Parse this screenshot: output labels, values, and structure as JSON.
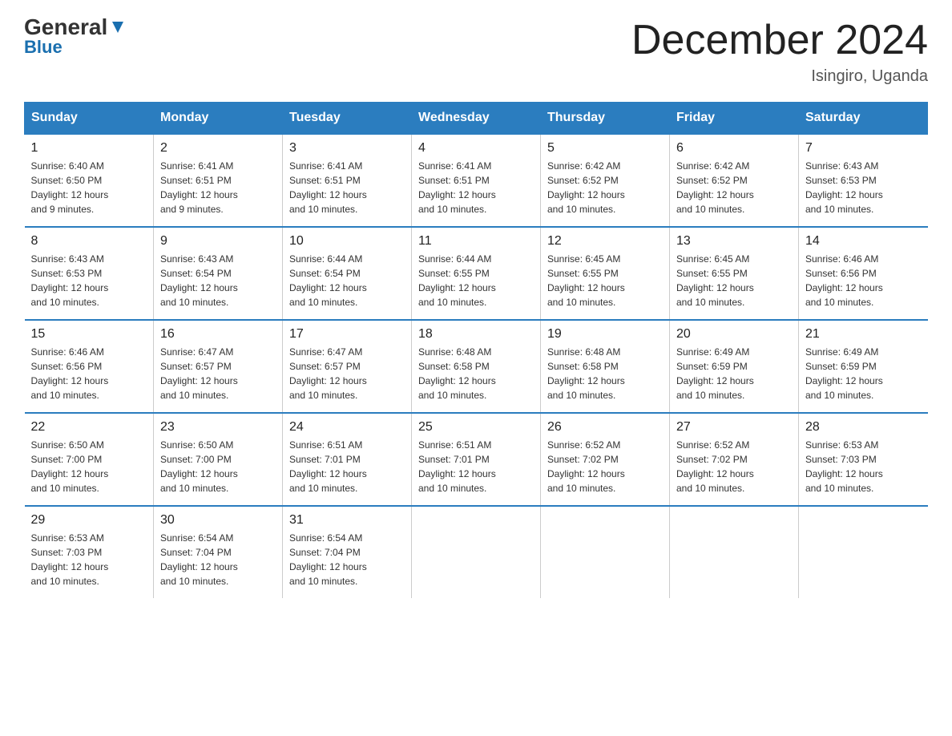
{
  "logo": {
    "general": "General",
    "blue": "Blue"
  },
  "title": "December 2024",
  "location": "Isingiro, Uganda",
  "days_of_week": [
    "Sunday",
    "Monday",
    "Tuesday",
    "Wednesday",
    "Thursday",
    "Friday",
    "Saturday"
  ],
  "weeks": [
    [
      {
        "day": "1",
        "sunrise": "6:40 AM",
        "sunset": "6:50 PM",
        "daylight": "12 hours and 9 minutes."
      },
      {
        "day": "2",
        "sunrise": "6:41 AM",
        "sunset": "6:51 PM",
        "daylight": "12 hours and 9 minutes."
      },
      {
        "day": "3",
        "sunrise": "6:41 AM",
        "sunset": "6:51 PM",
        "daylight": "12 hours and 10 minutes."
      },
      {
        "day": "4",
        "sunrise": "6:41 AM",
        "sunset": "6:51 PM",
        "daylight": "12 hours and 10 minutes."
      },
      {
        "day": "5",
        "sunrise": "6:42 AM",
        "sunset": "6:52 PM",
        "daylight": "12 hours and 10 minutes."
      },
      {
        "day": "6",
        "sunrise": "6:42 AM",
        "sunset": "6:52 PM",
        "daylight": "12 hours and 10 minutes."
      },
      {
        "day": "7",
        "sunrise": "6:43 AM",
        "sunset": "6:53 PM",
        "daylight": "12 hours and 10 minutes."
      }
    ],
    [
      {
        "day": "8",
        "sunrise": "6:43 AM",
        "sunset": "6:53 PM",
        "daylight": "12 hours and 10 minutes."
      },
      {
        "day": "9",
        "sunrise": "6:43 AM",
        "sunset": "6:54 PM",
        "daylight": "12 hours and 10 minutes."
      },
      {
        "day": "10",
        "sunrise": "6:44 AM",
        "sunset": "6:54 PM",
        "daylight": "12 hours and 10 minutes."
      },
      {
        "day": "11",
        "sunrise": "6:44 AM",
        "sunset": "6:55 PM",
        "daylight": "12 hours and 10 minutes."
      },
      {
        "day": "12",
        "sunrise": "6:45 AM",
        "sunset": "6:55 PM",
        "daylight": "12 hours and 10 minutes."
      },
      {
        "day": "13",
        "sunrise": "6:45 AM",
        "sunset": "6:55 PM",
        "daylight": "12 hours and 10 minutes."
      },
      {
        "day": "14",
        "sunrise": "6:46 AM",
        "sunset": "6:56 PM",
        "daylight": "12 hours and 10 minutes."
      }
    ],
    [
      {
        "day": "15",
        "sunrise": "6:46 AM",
        "sunset": "6:56 PM",
        "daylight": "12 hours and 10 minutes."
      },
      {
        "day": "16",
        "sunrise": "6:47 AM",
        "sunset": "6:57 PM",
        "daylight": "12 hours and 10 minutes."
      },
      {
        "day": "17",
        "sunrise": "6:47 AM",
        "sunset": "6:57 PM",
        "daylight": "12 hours and 10 minutes."
      },
      {
        "day": "18",
        "sunrise": "6:48 AM",
        "sunset": "6:58 PM",
        "daylight": "12 hours and 10 minutes."
      },
      {
        "day": "19",
        "sunrise": "6:48 AM",
        "sunset": "6:58 PM",
        "daylight": "12 hours and 10 minutes."
      },
      {
        "day": "20",
        "sunrise": "6:49 AM",
        "sunset": "6:59 PM",
        "daylight": "12 hours and 10 minutes."
      },
      {
        "day": "21",
        "sunrise": "6:49 AM",
        "sunset": "6:59 PM",
        "daylight": "12 hours and 10 minutes."
      }
    ],
    [
      {
        "day": "22",
        "sunrise": "6:50 AM",
        "sunset": "7:00 PM",
        "daylight": "12 hours and 10 minutes."
      },
      {
        "day": "23",
        "sunrise": "6:50 AM",
        "sunset": "7:00 PM",
        "daylight": "12 hours and 10 minutes."
      },
      {
        "day": "24",
        "sunrise": "6:51 AM",
        "sunset": "7:01 PM",
        "daylight": "12 hours and 10 minutes."
      },
      {
        "day": "25",
        "sunrise": "6:51 AM",
        "sunset": "7:01 PM",
        "daylight": "12 hours and 10 minutes."
      },
      {
        "day": "26",
        "sunrise": "6:52 AM",
        "sunset": "7:02 PM",
        "daylight": "12 hours and 10 minutes."
      },
      {
        "day": "27",
        "sunrise": "6:52 AM",
        "sunset": "7:02 PM",
        "daylight": "12 hours and 10 minutes."
      },
      {
        "day": "28",
        "sunrise": "6:53 AM",
        "sunset": "7:03 PM",
        "daylight": "12 hours and 10 minutes."
      }
    ],
    [
      {
        "day": "29",
        "sunrise": "6:53 AM",
        "sunset": "7:03 PM",
        "daylight": "12 hours and 10 minutes."
      },
      {
        "day": "30",
        "sunrise": "6:54 AM",
        "sunset": "7:04 PM",
        "daylight": "12 hours and 10 minutes."
      },
      {
        "day": "31",
        "sunrise": "6:54 AM",
        "sunset": "7:04 PM",
        "daylight": "12 hours and 10 minutes."
      },
      null,
      null,
      null,
      null
    ]
  ]
}
